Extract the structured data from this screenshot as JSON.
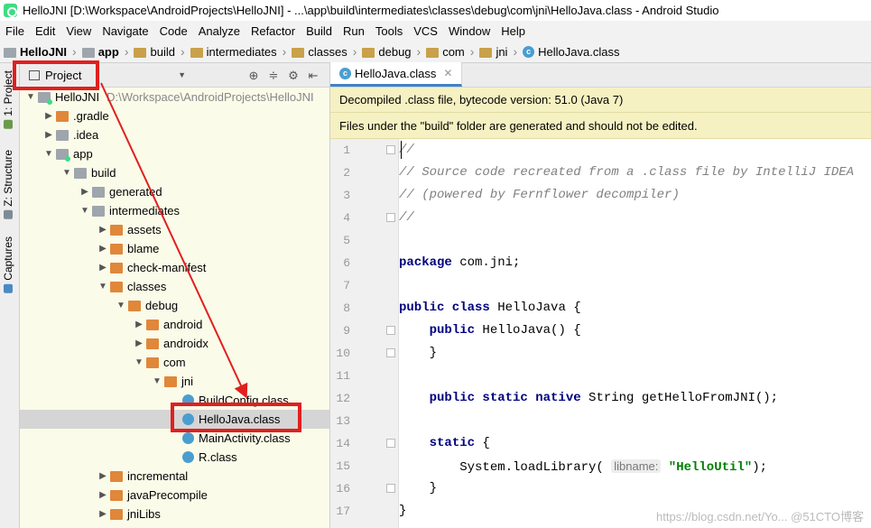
{
  "window": {
    "title": "HelloJNI [D:\\Workspace\\AndroidProjects\\HelloJNI] - ...\\app\\build\\intermediates\\classes\\debug\\com\\jni\\HelloJava.class - Android Studio"
  },
  "menu": [
    "File",
    "Edit",
    "View",
    "Navigate",
    "Code",
    "Analyze",
    "Refactor",
    "Build",
    "Run",
    "Tools",
    "VCS",
    "Window",
    "Help"
  ],
  "breadcrumbs": [
    "HelloJNI",
    "app",
    "build",
    "intermediates",
    "classes",
    "debug",
    "com",
    "jni",
    "HelloJava.class"
  ],
  "side_tabs": [
    "1: Project",
    "Z: Structure",
    "Captures"
  ],
  "project_panel": {
    "view_label": "Project"
  },
  "tree": [
    {
      "label": "HelloJNI",
      "path": "D:\\Workspace\\AndroidProjects\\HelloJNI",
      "indent": 0,
      "arrow": "down",
      "icon": "mod"
    },
    {
      "label": ".gradle",
      "indent": 1,
      "arrow": "right",
      "icon": "orange"
    },
    {
      "label": ".idea",
      "indent": 1,
      "arrow": "right",
      "icon": "gray"
    },
    {
      "label": "app",
      "indent": 1,
      "arrow": "down",
      "icon": "mod"
    },
    {
      "label": "build",
      "indent": 2,
      "arrow": "down",
      "icon": "gray"
    },
    {
      "label": "generated",
      "indent": 3,
      "arrow": "right",
      "icon": "gray"
    },
    {
      "label": "intermediates",
      "indent": 3,
      "arrow": "down",
      "icon": "gray"
    },
    {
      "label": "assets",
      "indent": 4,
      "arrow": "right",
      "icon": "orange"
    },
    {
      "label": "blame",
      "indent": 4,
      "arrow": "right",
      "icon": "orange"
    },
    {
      "label": "check-manifest",
      "indent": 4,
      "arrow": "right",
      "icon": "orange"
    },
    {
      "label": "classes",
      "indent": 4,
      "arrow": "down",
      "icon": "orange"
    },
    {
      "label": "debug",
      "indent": 5,
      "arrow": "down",
      "icon": "orange"
    },
    {
      "label": "android",
      "indent": 6,
      "arrow": "right",
      "icon": "orange"
    },
    {
      "label": "androidx",
      "indent": 6,
      "arrow": "right",
      "icon": "orange"
    },
    {
      "label": "com",
      "indent": 6,
      "arrow": "down",
      "icon": "orange"
    },
    {
      "label": "jni",
      "indent": 7,
      "arrow": "down",
      "icon": "orange"
    },
    {
      "label": "BuildConfig.class",
      "indent": 8,
      "arrow": "",
      "icon": "cls"
    },
    {
      "label": "HelloJava.class",
      "indent": 8,
      "arrow": "",
      "icon": "cls",
      "selected": true
    },
    {
      "label": "MainActivity.class",
      "indent": 8,
      "arrow": "",
      "icon": "cls"
    },
    {
      "label": "R.class",
      "indent": 8,
      "arrow": "",
      "icon": "cls"
    },
    {
      "label": "incremental",
      "indent": 4,
      "arrow": "right",
      "icon": "orange"
    },
    {
      "label": "javaPrecompile",
      "indent": 4,
      "arrow": "right",
      "icon": "orange"
    },
    {
      "label": "jniLibs",
      "indent": 4,
      "arrow": "right",
      "icon": "orange"
    }
  ],
  "editor": {
    "tab_label": "HelloJava.class",
    "banner1": "Decompiled .class file, bytecode version: 51.0 (Java 7)",
    "banner2": "Files under the \"build\" folder are generated and should not be edited.",
    "lines": [
      {
        "n": "1",
        "html": "<span class=\"cm\">//</span>"
      },
      {
        "n": "2",
        "html": "<span class=\"cm\">// Source code recreated from a .class file by IntelliJ IDEA</span>"
      },
      {
        "n": "3",
        "html": "<span class=\"cm\">// (powered by Fernflower decompiler)</span>"
      },
      {
        "n": "4",
        "html": "<span class=\"cm\">//</span>"
      },
      {
        "n": "5",
        "html": ""
      },
      {
        "n": "6",
        "html": "<span class=\"kw\">package</span> com.jni;"
      },
      {
        "n": "7",
        "html": ""
      },
      {
        "n": "8",
        "html": "<span class=\"kw\">public class</span> HelloJava {"
      },
      {
        "n": "9",
        "html": "    <span class=\"kw\">public</span> HelloJava() {"
      },
      {
        "n": "10",
        "html": "    }"
      },
      {
        "n": "11",
        "html": ""
      },
      {
        "n": "12",
        "html": "    <span class=\"kw\">public static native</span> String getHelloFromJNI();"
      },
      {
        "n": "13",
        "html": ""
      },
      {
        "n": "14",
        "html": "    <span class=\"kw\">static</span> {"
      },
      {
        "n": "15",
        "html": "        System.loadLibrary( <span class=\"hint\">libname:</span> <span class=\"str\">\"HelloUtil\"</span>);"
      },
      {
        "n": "16",
        "html": "    }"
      },
      {
        "n": "17",
        "html": "}"
      }
    ]
  },
  "watermark": "https://blog.csdn.net/Yo...   @51CTO博客",
  "colors": {
    "annotation": "#e02020",
    "tree_bg": "#fbfbe9",
    "banner": "#f6f1c2"
  }
}
